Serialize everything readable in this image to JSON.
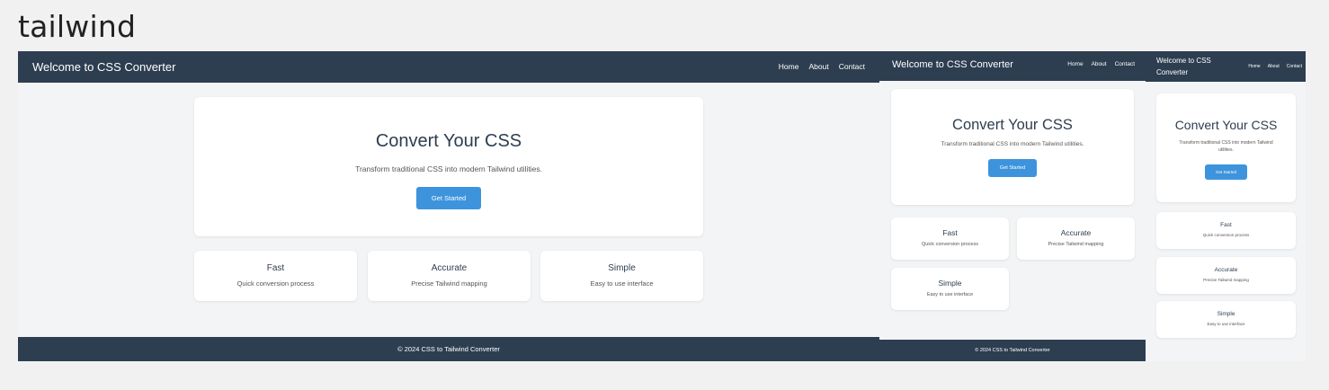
{
  "page": {
    "heading": "tailwind"
  },
  "site": {
    "brand": "Welcome to CSS Converter",
    "nav": [
      "Home",
      "About",
      "Contact"
    ],
    "hero": {
      "title": "Convert Your CSS",
      "subtitle": "Transform traditional CSS into modern Tailwind utilities.",
      "button": "Get Started"
    },
    "features": [
      {
        "title": "Fast",
        "desc": "Quick conversion process"
      },
      {
        "title": "Accurate",
        "desc": "Precise Tailwind mapping"
      },
      {
        "title": "Simple",
        "desc": "Easy to use interface"
      }
    ],
    "footer": "© 2024 CSS to Tailwind Converter"
  },
  "colors": {
    "navbar": "#2d3e50",
    "button": "#3d94dc",
    "background": "#f3f4f6"
  }
}
